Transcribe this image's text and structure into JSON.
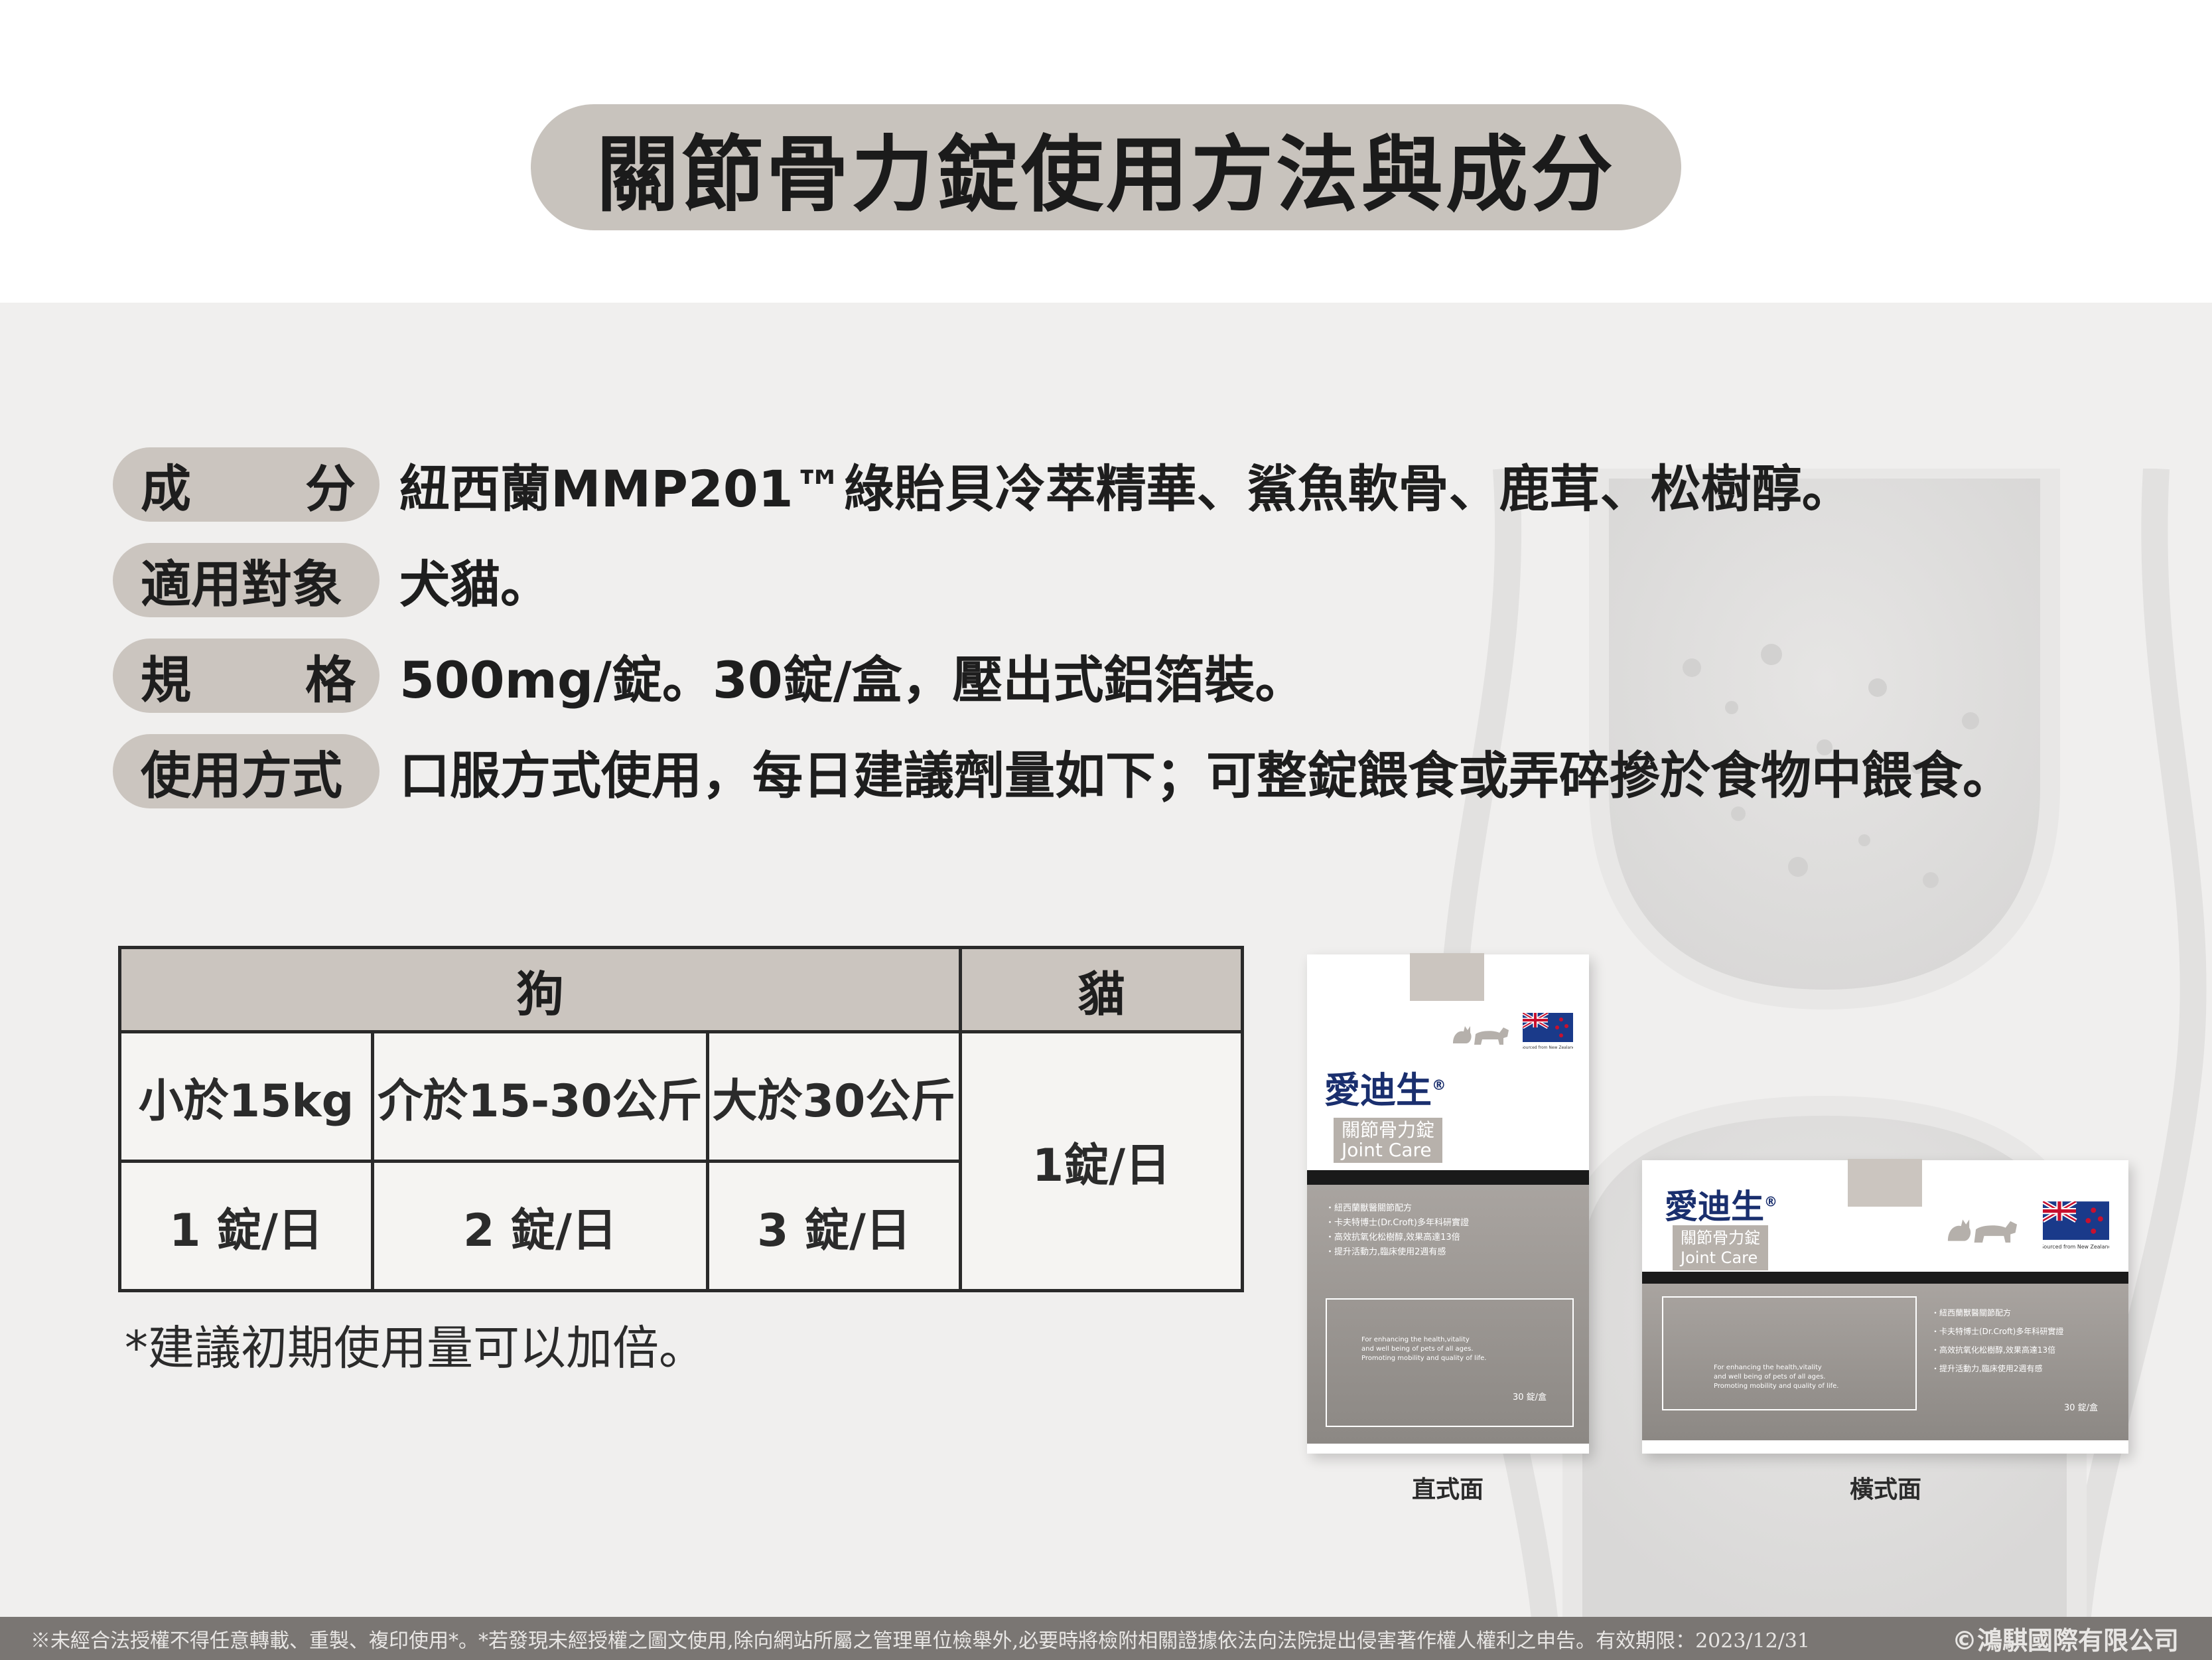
{
  "title": "關節骨力錠使用方法與成分",
  "specs": [
    {
      "label_a": "成",
      "label_b": "分",
      "value": "紐西蘭MMP201™綠貽貝冷萃精華、鯊魚軟骨、鹿茸、松樹醇。"
    },
    {
      "label": "適用對象",
      "value": "犬貓。"
    },
    {
      "label_a": "規",
      "label_b": "格",
      "value": "500mg/錠。30錠/盒，壓出式鋁箔裝。"
    },
    {
      "label": "使用方式",
      "value": "口服方式使用，每日建議劑量如下；可整錠餵食或弄碎摻於食物中餵食。"
    }
  ],
  "dosage_table": {
    "header_dog": "狗",
    "header_cat": "貓",
    "dog_weights": [
      "小於15kg",
      "介於15-30公斤",
      "大於30公斤"
    ],
    "dog_doses": [
      "1 錠/日",
      "2 錠/日",
      "3 錠/日"
    ],
    "cat_dose": "1錠/日"
  },
  "note": "*建議初期使用量可以加倍。",
  "product": {
    "brand": "愛迪生",
    "name_zh": "關節骨力錠",
    "name_en": "Joint Care",
    "bullets": [
      "・紐西蘭獸醫關節配方",
      "・卡夫特博士(Dr.Croft)多年科研實證",
      "・高效抗氧化松樹醇,效果高達13倍",
      "・提升活動力,臨床使用2週有感"
    ],
    "en_desc": [
      "For enhancing the health,vitality",
      "and well being of pets of all ages.",
      "Promoting mobility and quality of life."
    ],
    "quantity": "30 錠/盒",
    "flag_caption": "Sourced from New Zealand",
    "caption_vertical": "直式面",
    "caption_horizontal": "橫式面"
  },
  "footer": {
    "notice": "※未經合法授權不得任意轉載、重製、複印使用*。*若發現未經授權之圖文使用,除向網站所屬之管理單位檢舉外,必要時將檢附相關證據依法向法院提出侵害著作權人權利之申告。有效期限：2023/12/31",
    "copyright": "©鴻騏國際有限公司"
  },
  "colors": {
    "pill": "#cbc5bf",
    "main_bg": "#f0efee",
    "footer_bg": "#7a7673",
    "brand_blue": "#1a2f6e"
  }
}
